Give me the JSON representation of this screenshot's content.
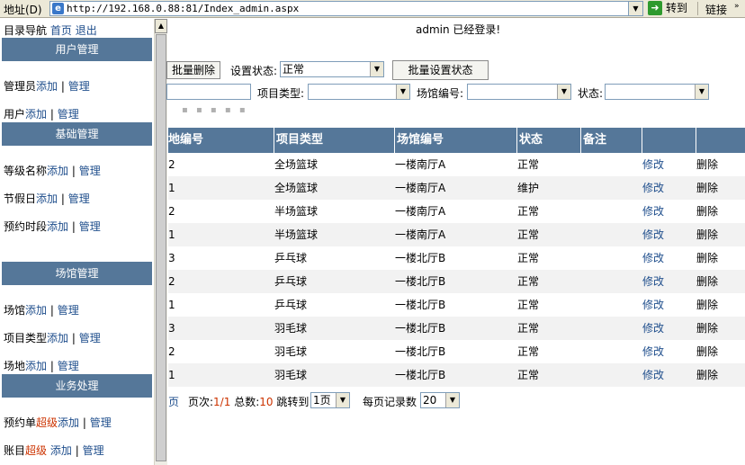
{
  "addressbar": {
    "label": "地址(D)",
    "url": "http://192.168.0.88:81/Index_admin.aspx",
    "go_label": "转到",
    "links_label": "链接"
  },
  "sidebar": {
    "nav_title": "目录导航",
    "home_link": "首页",
    "logout_link": "退出",
    "sections": [
      {
        "title": "用户管理"
      },
      {
        "title": "基础管理"
      },
      {
        "title": "场馆管理"
      },
      {
        "title": "业务处理"
      }
    ],
    "items": [
      {
        "name": "管理员",
        "add": "添加",
        "manage": "管理"
      },
      {
        "name": "用户",
        "add": "添加",
        "manage": "管理"
      },
      {
        "name": "等级名称",
        "add": "添加",
        "manage": "管理"
      },
      {
        "name": "节假日",
        "add": "添加",
        "manage": "管理"
      },
      {
        "name": "预约时段",
        "add": "添加",
        "manage": "管理"
      },
      {
        "name": "场馆",
        "add": "添加",
        "manage": "管理"
      },
      {
        "name": "项目类型",
        "add": "添加",
        "manage": "管理"
      },
      {
        "name": "场地",
        "add": "添加",
        "manage": "管理"
      },
      {
        "name": "预约单",
        "highlight": "超级",
        "add": "添加",
        "manage": "管理"
      },
      {
        "name": "账目",
        "highlight": "超级",
        "add": "添加",
        "manage": "管理"
      }
    ],
    "separator": "|"
  },
  "main": {
    "login_message": "admin 已经登录!",
    "batch_delete": "批量删除",
    "set_status_label": "设置状态:",
    "set_status_value": "正常",
    "batch_set_status": "批量设置状态",
    "filters": {
      "project_type_label": "项目类型:",
      "project_type_value": "",
      "venue_no_label": "场馆编号:",
      "venue_no_value": "",
      "status_label": "状态:",
      "status_value": ""
    },
    "columns": [
      "地编号",
      "项目类型",
      "场馆编号",
      "状态",
      "备注",
      "",
      ""
    ],
    "rows": [
      {
        "id": "2",
        "type": "全场篮球",
        "venue": "一楼南厅A",
        "status": "正常",
        "note": "",
        "edit": "修改",
        "delete": "删除"
      },
      {
        "id": "1",
        "type": "全场篮球",
        "venue": "一楼南厅A",
        "status": "维护",
        "note": "",
        "edit": "修改",
        "delete": "删除"
      },
      {
        "id": "2",
        "type": "半场篮球",
        "venue": "一楼南厅A",
        "status": "正常",
        "note": "",
        "edit": "修改",
        "delete": "删除"
      },
      {
        "id": "1",
        "type": "半场篮球",
        "venue": "一楼南厅A",
        "status": "正常",
        "note": "",
        "edit": "修改",
        "delete": "删除"
      },
      {
        "id": "3",
        "type": "乒乓球",
        "venue": "一楼北厅B",
        "status": "正常",
        "note": "",
        "edit": "修改",
        "delete": "删除"
      },
      {
        "id": "2",
        "type": "乒乓球",
        "venue": "一楼北厅B",
        "status": "正常",
        "note": "",
        "edit": "修改",
        "delete": "删除"
      },
      {
        "id": "1",
        "type": "乒乓球",
        "venue": "一楼北厅B",
        "status": "正常",
        "note": "",
        "edit": "修改",
        "delete": "删除"
      },
      {
        "id": "3",
        "type": "羽毛球",
        "venue": "一楼北厅B",
        "status": "正常",
        "note": "",
        "edit": "修改",
        "delete": "删除"
      },
      {
        "id": "2",
        "type": "羽毛球",
        "venue": "一楼北厅B",
        "status": "正常",
        "note": "",
        "edit": "修改",
        "delete": "删除"
      },
      {
        "id": "1",
        "type": "羽毛球",
        "venue": "一楼北厅B",
        "status": "正常",
        "note": "",
        "edit": "修改",
        "delete": "删除"
      }
    ],
    "pager": {
      "last_page": "页",
      "page_label": "页次:",
      "page_value": "1/1",
      "total_label": "总数:",
      "total_value": "10",
      "jump_label": "跳转到",
      "jump_value": "1页",
      "per_page_label": "每页记录数",
      "per_page_value": "20"
    }
  },
  "colors": {
    "header_bg": "#557799",
    "link": "#1f4e8c",
    "red": "#cc3300"
  }
}
